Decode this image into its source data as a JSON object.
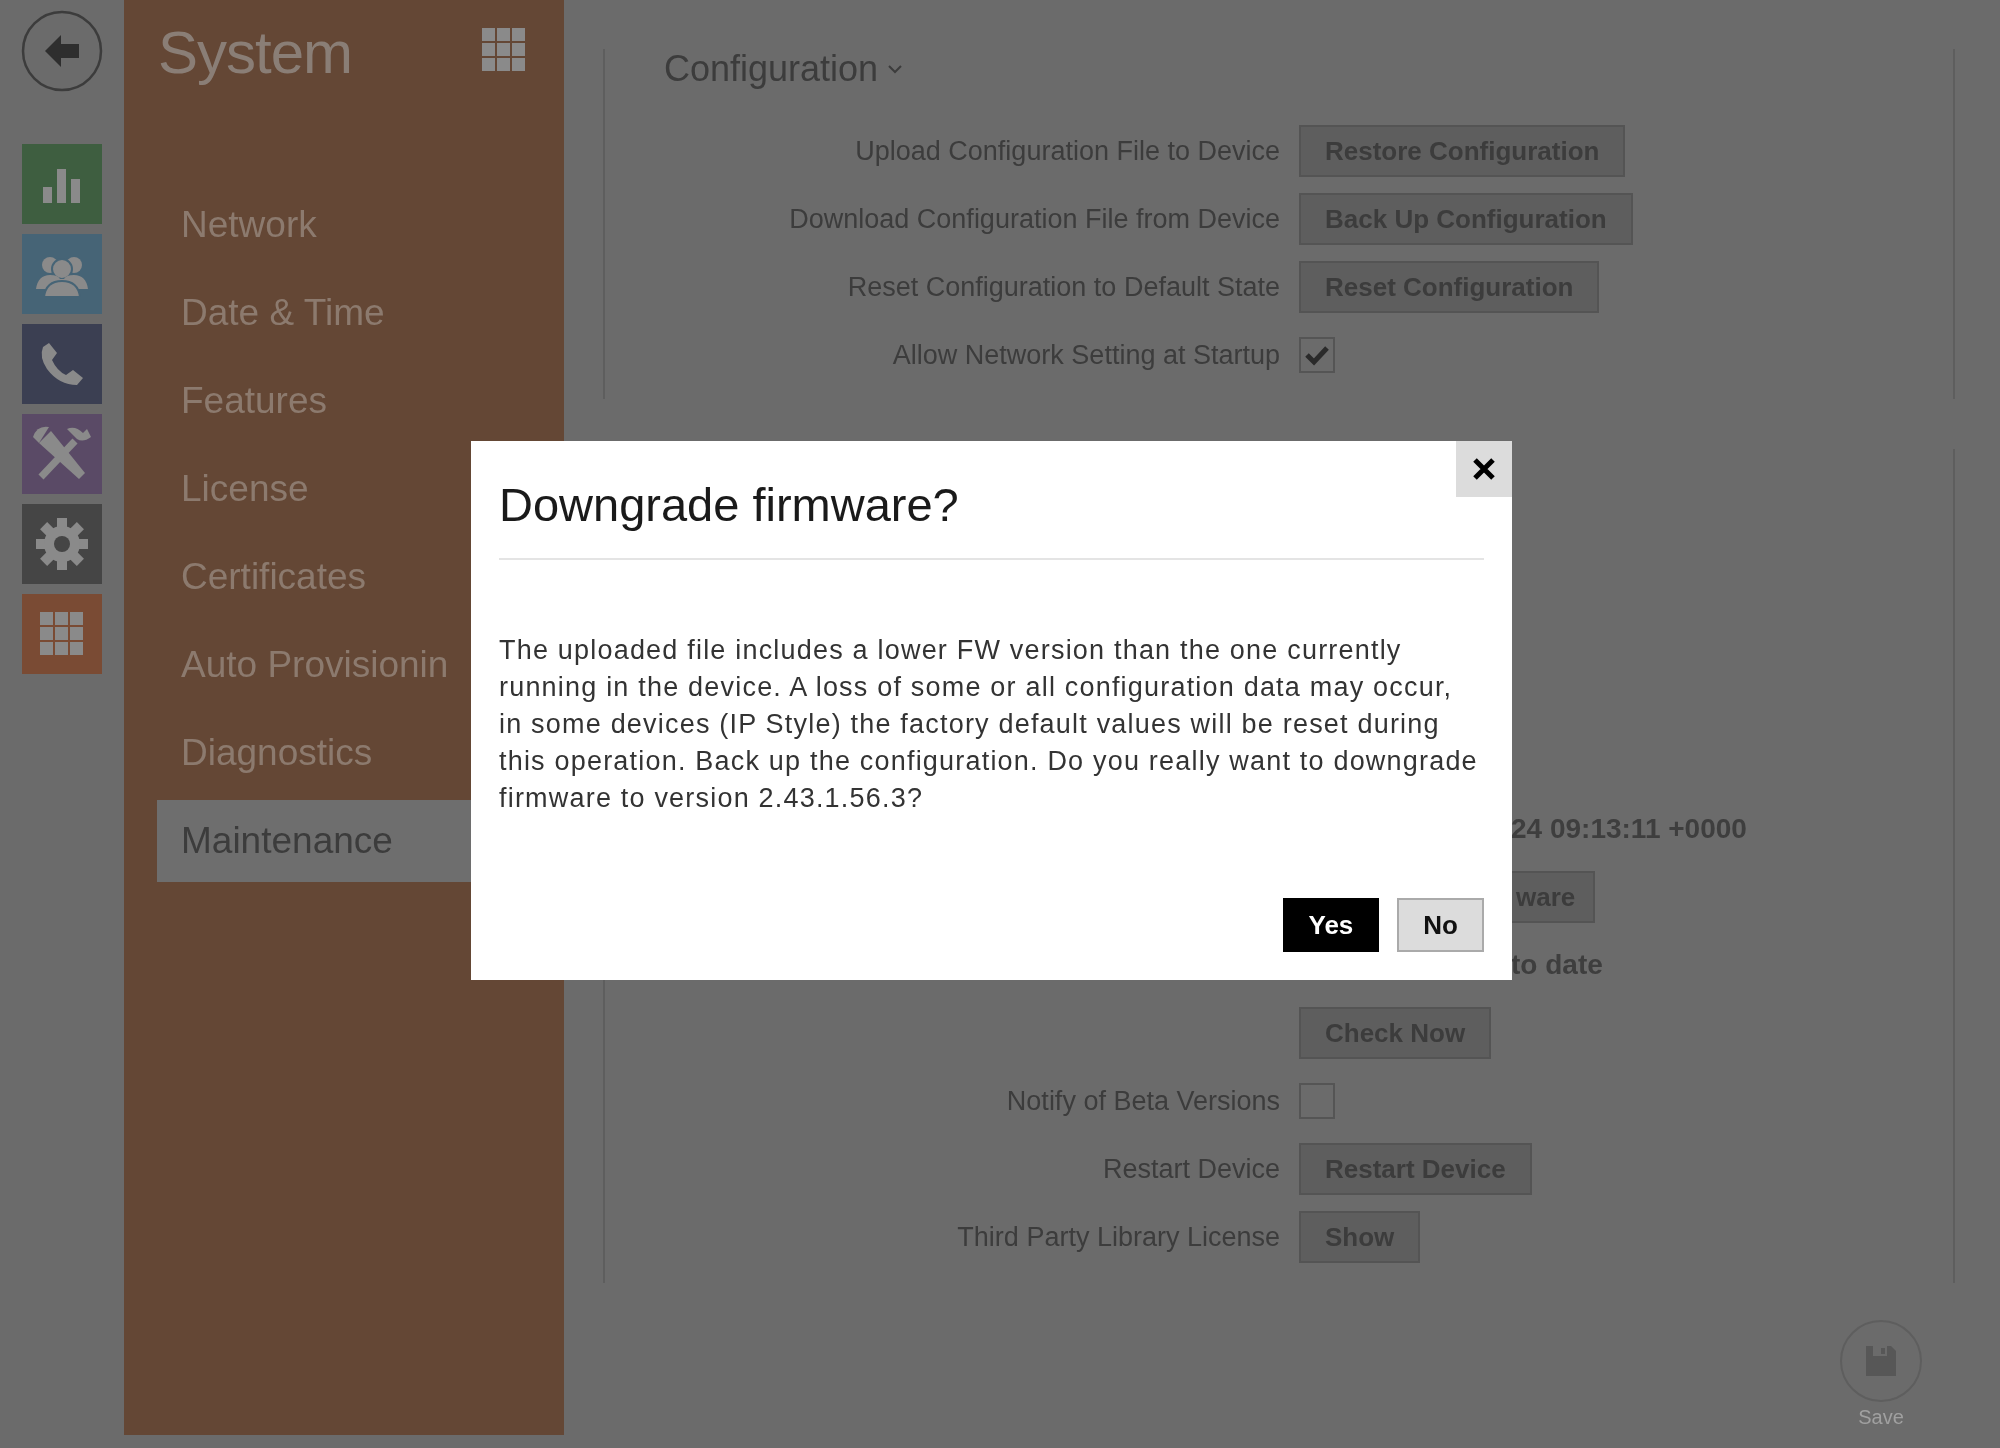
{
  "rail": [
    {
      "kind": "back"
    },
    {
      "kind": "stats",
      "color": "#3e5e40"
    },
    {
      "kind": "users",
      "color": "#466476"
    },
    {
      "kind": "phone",
      "color": "#3b3f52"
    },
    {
      "kind": "tools",
      "color": "#5a4a66"
    },
    {
      "kind": "gear",
      "color": "#454545"
    },
    {
      "kind": "grid",
      "color": "#7a4b34"
    }
  ],
  "sidebar": {
    "title": "System",
    "items": [
      {
        "label": "Network",
        "selected": false
      },
      {
        "label": "Date & Time",
        "selected": false
      },
      {
        "label": "Features",
        "selected": false
      },
      {
        "label": "License",
        "selected": false
      },
      {
        "label": "Certificates",
        "selected": false
      },
      {
        "label": "Auto Provisionin",
        "selected": false
      },
      {
        "label": "Diagnostics",
        "selected": false
      },
      {
        "label": "Maintenance",
        "selected": true
      }
    ]
  },
  "configuration": {
    "title": "Configuration",
    "rows": [
      {
        "kind": "button",
        "label": "Upload Configuration File to Device",
        "button": "Restore Configuration"
      },
      {
        "kind": "button",
        "label": "Download Configuration File from Device",
        "button": "Back Up Configuration"
      },
      {
        "kind": "button",
        "label": "Reset Configuration to Default State",
        "button": "Reset Configuration"
      },
      {
        "kind": "checkbox",
        "label": "Allow Network Setting at Startup",
        "checked": true
      }
    ]
  },
  "firmware": {
    "rows": [
      {
        "kind": "text",
        "value": "24 09:13:11 +0000"
      },
      {
        "kind": "partial-button",
        "button": "ware"
      },
      {
        "kind": "text",
        "value": "to date"
      },
      {
        "kind": "button",
        "button": "Check Now"
      },
      {
        "kind": "checkbox",
        "label": "Notify of Beta Versions",
        "checked": false
      },
      {
        "kind": "button",
        "label": "Restart Device",
        "button": "Restart Device"
      },
      {
        "kind": "button",
        "label": "Third Party Library License",
        "button": "Show"
      }
    ]
  },
  "save": {
    "label": "Save"
  },
  "dialog": {
    "title": "Downgrade firmware?",
    "message": "The uploaded file includes a lower FW version than the one currently running in the device. A loss of some or all configuration data may occur, in some devices (IP Style) the factory default values will be reset during this operation. Back up the configuration. Do you really want to downgrade firmware to version 2.43.1.56.3?",
    "buttons": [
      {
        "kind": "primary",
        "label": "Yes"
      },
      {
        "kind": "secondary",
        "label": "No"
      }
    ]
  }
}
